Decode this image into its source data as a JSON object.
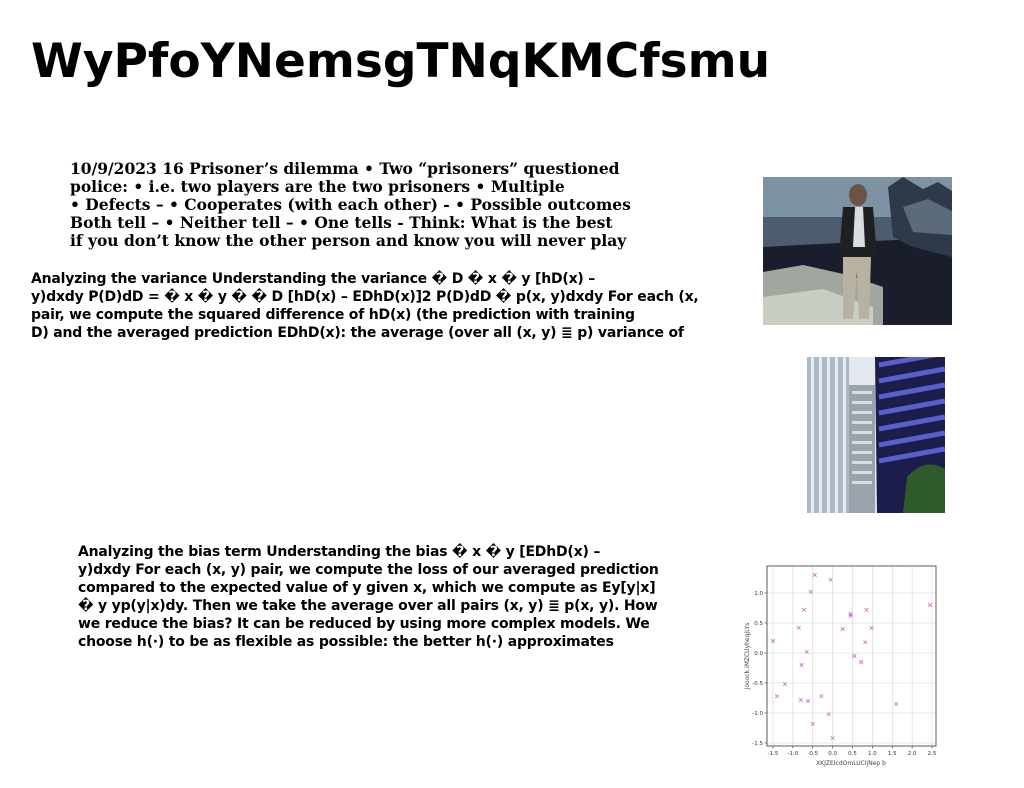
{
  "page": {
    "title": "WyPfoYNemsgTNqKMCfsmu"
  },
  "text_blocks": {
    "prisoner": "10/9/2023 16 Prisoner’s dilemma • Two “prisoners” questioned\npolice: • i.e. two players are the two prisoners • Multiple\n• Defects – • Cooperates (with each other) - • Possible outcomes\nBoth tell – • Neither tell – • One tells - Think: What is the best\nif you don’t know the other person and know you will never play",
    "variance": "Analyzing the variance Understanding the variance � D � x � y [hD(x) –\ny)dxdy P(D)dD = � x � y � � D [hD(x) – EDhD(x)]2 P(D)dD � p(x, y)dxdy For each (x,\npair, we compute the squared difference of hD(x) (the prediction with training\nD) and the averaged prediction EDhD(x): the average (over all (x, y) ≣ p) variance of",
    "bias": "Analyzing the bias term Understanding the bias � x � y [EDhD(x) –\ny)dxdy For each (x, y) pair, we compute the loss of our averaged prediction\ncompared to the expected value of y given x, which we compute as Ey[y|x]\n� y yp(y|x)dy. Then we take the average over all pairs (x, y) ≣ p(x, y). How\nwe reduce the bias? It can be reduced by using more complex models. We\nchoose h(·) to be as flexible as possible: the better h(·) approximates"
  },
  "chart_data": {
    "type": "scatter",
    "marker": "x",
    "color": "#cc66cc",
    "grid": true,
    "xlabel": "XKJZEIcdOmLUCIjNep b",
    "ylabel": "Jooock iMZCUyheqjLYs",
    "xlim": [
      -1.65,
      2.6
    ],
    "ylim": [
      -1.55,
      1.45
    ],
    "xticks": [
      "-1.5",
      "-1.0",
      "-0.5",
      "0.0",
      "0.5",
      "1.0",
      "1.5",
      "2.0",
      "2.5"
    ],
    "yticks": [
      "1.0",
      "0.5",
      "0.0",
      "-0.5",
      "-1.0",
      "-1.5"
    ],
    "points": [
      {
        "x": -1.5,
        "y": 0.2
      },
      {
        "x": -1.4,
        "y": -0.72
      },
      {
        "x": -1.2,
        "y": -0.52
      },
      {
        "x": -0.85,
        "y": 0.42
      },
      {
        "x": -0.8,
        "y": -0.78
      },
      {
        "x": -0.78,
        "y": -0.2
      },
      {
        "x": -0.72,
        "y": 0.72
      },
      {
        "x": -0.65,
        "y": 0.02
      },
      {
        "x": -0.62,
        "y": -0.8
      },
      {
        "x": -0.55,
        "y": 1.02
      },
      {
        "x": -0.5,
        "y": -1.18
      },
      {
        "x": -0.45,
        "y": 1.3
      },
      {
        "x": -0.28,
        "y": -0.72
      },
      {
        "x": -0.1,
        "y": -1.02
      },
      {
        "x": -0.05,
        "y": 1.22
      },
      {
        "x": 0.0,
        "y": -1.42
      },
      {
        "x": 0.25,
        "y": 0.4
      },
      {
        "x": 0.45,
        "y": 0.65
      },
      {
        "x": 0.45,
        "y": 0.62
      },
      {
        "x": 0.55,
        "y": -0.05
      },
      {
        "x": 0.72,
        "y": -0.15
      },
      {
        "x": 0.82,
        "y": 0.18
      },
      {
        "x": 0.85,
        "y": 0.72
      },
      {
        "x": 0.98,
        "y": 0.42
      },
      {
        "x": 1.6,
        "y": -0.85
      },
      {
        "x": 2.45,
        "y": 0.8
      }
    ]
  }
}
